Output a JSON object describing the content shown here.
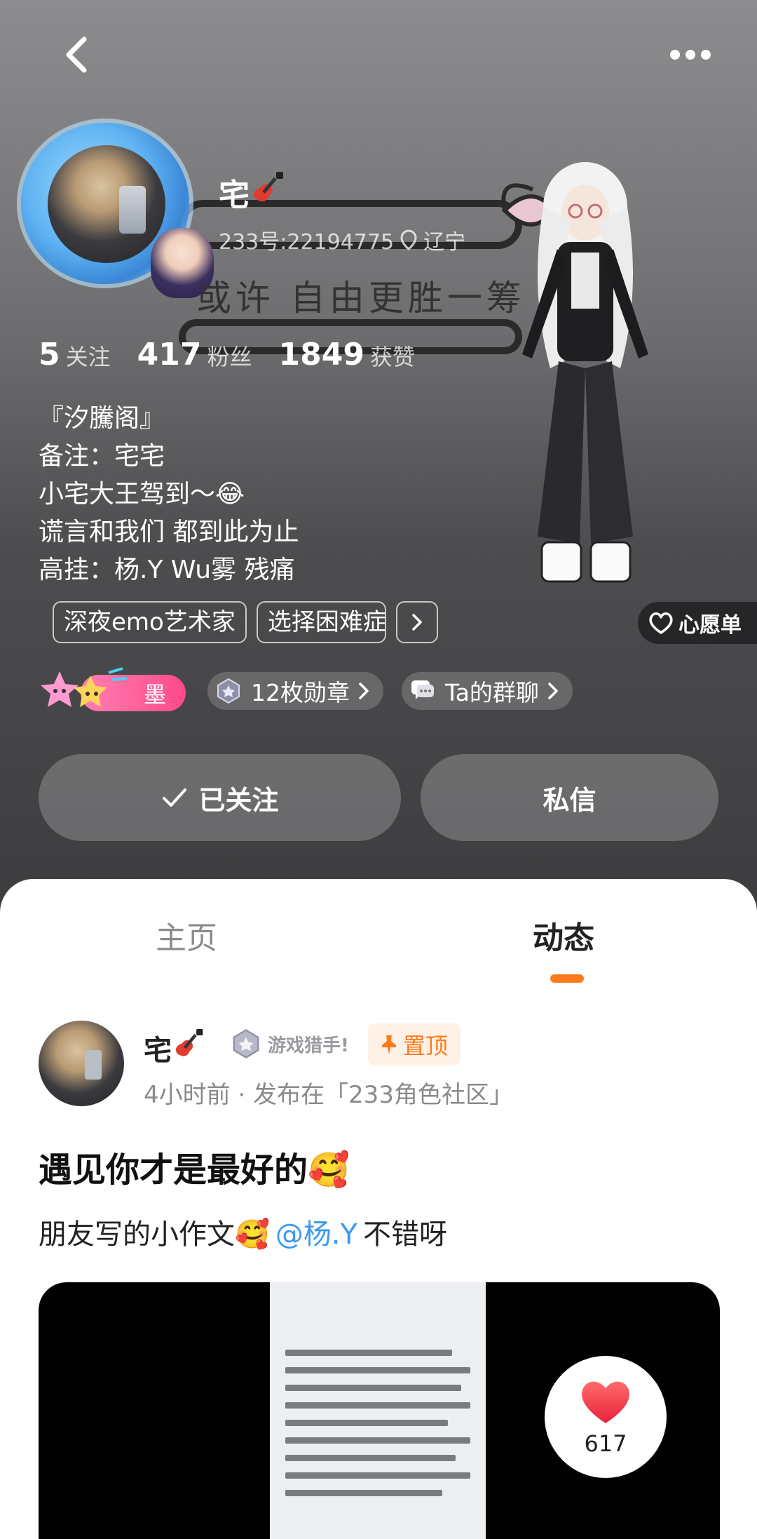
{
  "profile": {
    "username": "宅",
    "uid_text": "233号:22194775",
    "location": "辽宁",
    "sign_text": "或许 自由更胜一筹",
    "stats": [
      {
        "num": "5",
        "label": "关注"
      },
      {
        "num": "417",
        "label": "粉丝"
      },
      {
        "num": "1849",
        "label": "获赞"
      }
    ],
    "bio": [
      "『汐騰阁』",
      "备注：宅宅",
      "小宅大王驾到～😂",
      "谎言和我们 都到此为止",
      "高挂：杨.Y  Wu雾 残痛"
    ],
    "tags": [
      "深夜emo艺术家",
      "选择困难症"
    ],
    "wishlist_label": "心愿单",
    "level_label": "墨",
    "medals_label": "12枚勋章",
    "group_label": "Ta的群聊",
    "follow_label": "已关注",
    "message_label": "私信"
  },
  "tabs": {
    "home": "主页",
    "feed": "动态"
  },
  "post": {
    "author": "宅",
    "title_badge": "游戏猎手!",
    "pinned_label": "置顶",
    "meta": "4小时前 · 发布在「233角色社区」",
    "title": "遇见你才是最好的🥰",
    "body_prefix": "朋友写的小作文🥰",
    "mention": "@杨.Y",
    "body_suffix": "不错呀",
    "likes": "617"
  },
  "colors": {
    "accent": "#ff7a1a",
    "mention": "#3a9af0",
    "level_pink": "#ff4a8a"
  }
}
